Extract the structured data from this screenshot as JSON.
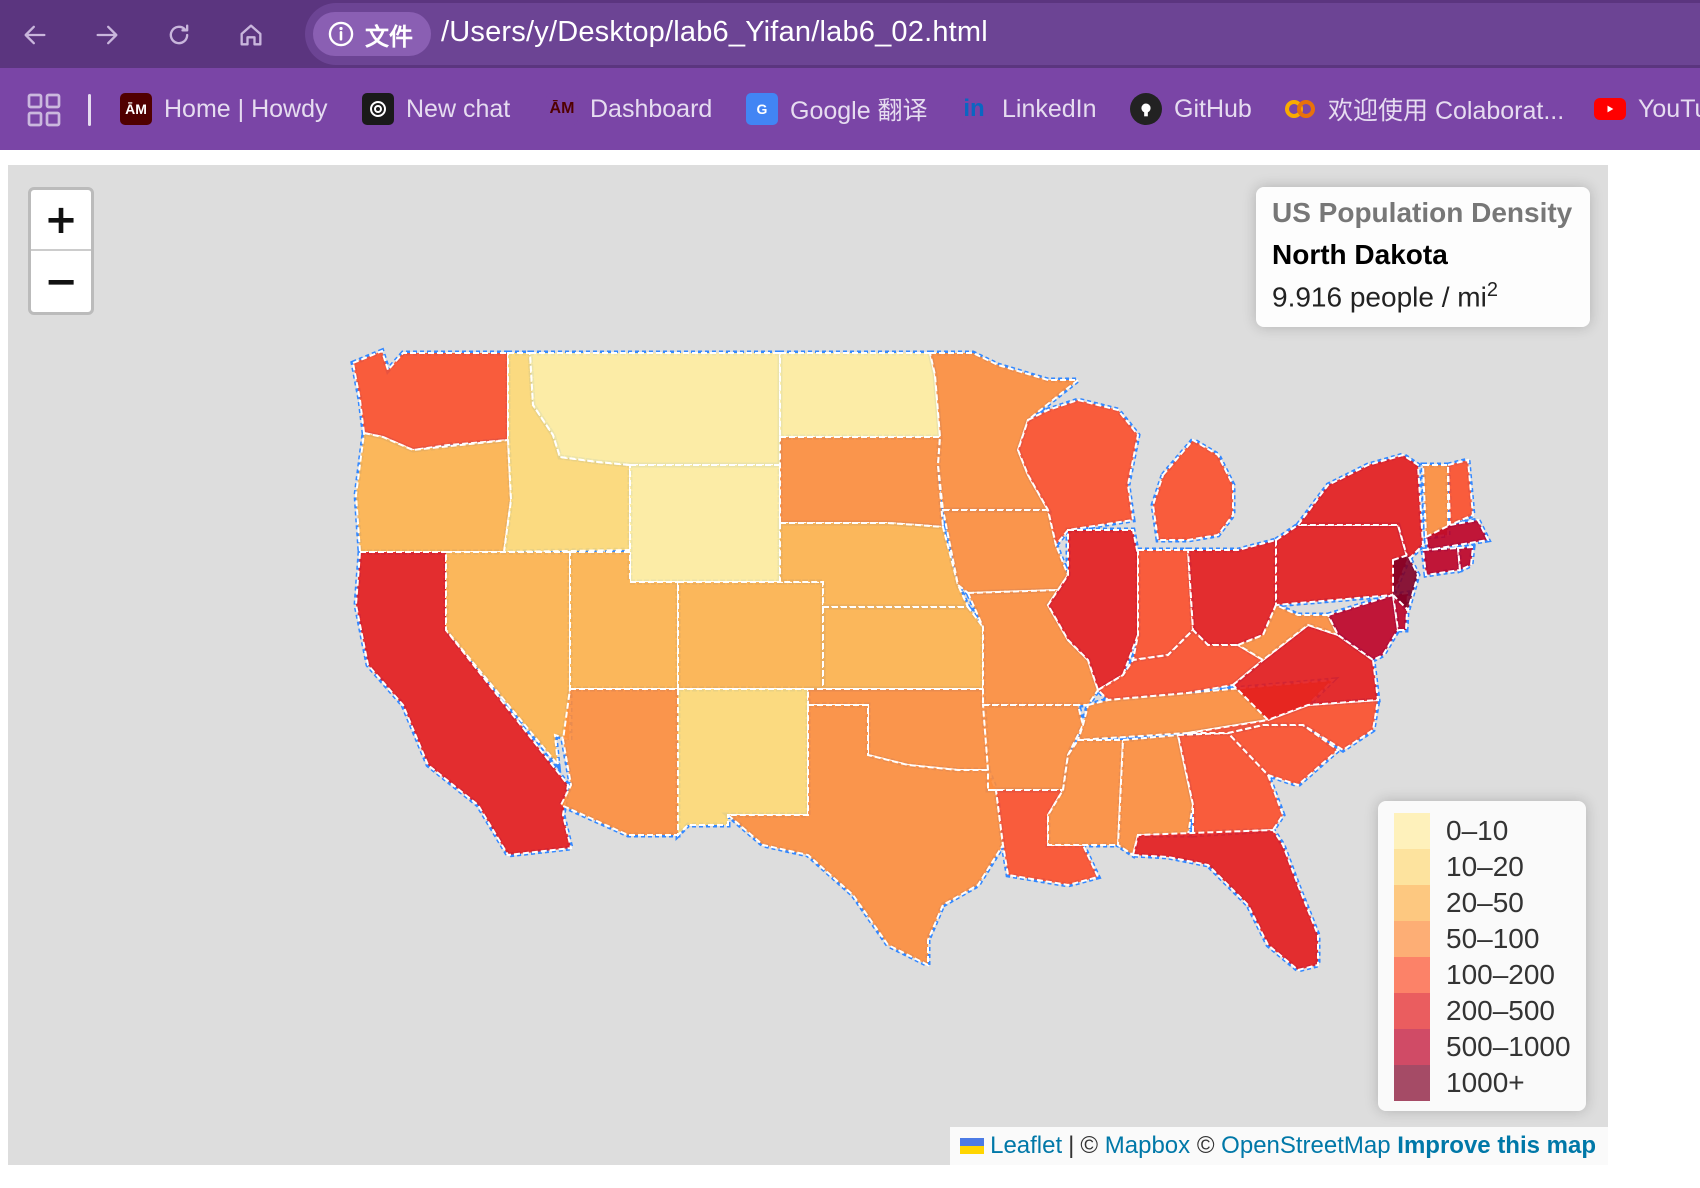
{
  "browser": {
    "site_info_label": "文件",
    "url": "/Users/y/Desktop/lab6_Yifan/lab6_02.html",
    "bookmarks": [
      {
        "label": "Home | Howdy",
        "icon": "tamu-icon",
        "color": "#500000"
      },
      {
        "label": "New chat",
        "icon": "openai-icon",
        "color": "#1a1a1a"
      },
      {
        "label": "Dashboard",
        "icon": "tamu-icon",
        "color": "#500000"
      },
      {
        "label": "Google 翻译",
        "icon": "google-translate-icon",
        "color": "#4285f4"
      },
      {
        "label": "LinkedIn",
        "icon": "linkedin-icon",
        "color": "#0a66c2"
      },
      {
        "label": "GitHub",
        "icon": "github-icon",
        "color": "#222222"
      },
      {
        "label": "欢迎使用 Colaborat...",
        "icon": "colab-icon",
        "color": "#f9ab00"
      },
      {
        "label": "YouTu",
        "icon": "youtube-icon",
        "color": "#ff0000"
      }
    ]
  },
  "map": {
    "zoom_in_label": "+",
    "zoom_out_label": "−",
    "info": {
      "title": "US Population Density",
      "state": "North Dakota",
      "value": "9.916",
      "unit": "people / mi",
      "unit_exponent": "2"
    },
    "legend": [
      {
        "label": "0–10",
        "color": "#FFEDA0"
      },
      {
        "label": "10–20",
        "color": "#FED976"
      },
      {
        "label": "20–50",
        "color": "#FEB24C"
      },
      {
        "label": "50–100",
        "color": "#FD8D3C"
      },
      {
        "label": "100–200",
        "color": "#FC4E2A"
      },
      {
        "label": "200–500",
        "color": "#E31A1C"
      },
      {
        "label": "500–1000",
        "color": "#BD0026"
      },
      {
        "label": "1000+",
        "color": "#800026"
      }
    ],
    "attribution": {
      "leaflet": "Leaflet",
      "sep": "|",
      "copy1": "©",
      "mapbox": "Mapbox",
      "copy2": "©",
      "osm": "OpenStreetMap",
      "improve": "Improve this map"
    },
    "states": [
      {
        "name": "Washington",
        "color": "#FC4E2A"
      },
      {
        "name": "Oregon",
        "color": "#FEB24C"
      },
      {
        "name": "California",
        "color": "#E31A1C"
      },
      {
        "name": "Idaho",
        "color": "#FED976"
      },
      {
        "name": "Nevada",
        "color": "#FEB24C"
      },
      {
        "name": "Montana",
        "color": "#FFEDA0"
      },
      {
        "name": "Wyoming",
        "color": "#FFEDA0"
      },
      {
        "name": "Utah",
        "color": "#FEB24C"
      },
      {
        "name": "Arizona",
        "color": "#FD8D3C"
      },
      {
        "name": "Colorado",
        "color": "#FEB24C"
      },
      {
        "name": "New Mexico",
        "color": "#FED976"
      },
      {
        "name": "North Dakota",
        "color": "#FFEDA0"
      },
      {
        "name": "South Dakota",
        "color": "#FD8D3C"
      },
      {
        "name": "Nebraska",
        "color": "#FEB24C"
      },
      {
        "name": "Kansas",
        "color": "#FEB24C"
      },
      {
        "name": "Oklahoma",
        "color": "#FD8D3C"
      },
      {
        "name": "Texas",
        "color": "#FD8D3C"
      },
      {
        "name": "Minnesota",
        "color": "#FD8D3C"
      },
      {
        "name": "Iowa",
        "color": "#FD8D3C"
      },
      {
        "name": "Missouri",
        "color": "#FD8D3C"
      },
      {
        "name": "Arkansas",
        "color": "#FD8D3C"
      },
      {
        "name": "Louisiana",
        "color": "#FC4E2A"
      },
      {
        "name": "Wisconsin",
        "color": "#FC4E2A"
      },
      {
        "name": "Illinois",
        "color": "#E31A1C"
      },
      {
        "name": "Michigan",
        "color": "#FC4E2A"
      },
      {
        "name": "Indiana",
        "color": "#FC4E2A"
      },
      {
        "name": "Ohio",
        "color": "#E31A1C"
      },
      {
        "name": "Kentucky",
        "color": "#FC4E2A"
      },
      {
        "name": "Tennessee",
        "color": "#FD8D3C"
      },
      {
        "name": "Mississippi",
        "color": "#FD8D3C"
      },
      {
        "name": "Alabama",
        "color": "#FD8D3C"
      },
      {
        "name": "Georgia",
        "color": "#FC4E2A"
      },
      {
        "name": "Florida",
        "color": "#E31A1C"
      },
      {
        "name": "South Carolina",
        "color": "#FC4E2A"
      },
      {
        "name": "North Carolina",
        "color": "#FC4E2A"
      },
      {
        "name": "Virginia",
        "color": "#E31A1C"
      },
      {
        "name": "West Virginia",
        "color": "#FD8D3C"
      },
      {
        "name": "Pennsylvania",
        "color": "#E31A1C"
      },
      {
        "name": "New York",
        "color": "#E31A1C"
      },
      {
        "name": "Maryland",
        "color": "#BD0026"
      },
      {
        "name": "Delaware",
        "color": "#BD0026"
      },
      {
        "name": "New Jersey",
        "color": "#800026"
      },
      {
        "name": "Vermont",
        "color": "#FD8D3C"
      },
      {
        "name": "New Hampshire",
        "color": "#FC4E2A"
      },
      {
        "name": "Massachusetts",
        "color": "#BD0026"
      },
      {
        "name": "Connecticut",
        "color": "#BD0026"
      },
      {
        "name": "Rhode Island",
        "color": "#BD0026"
      }
    ]
  }
}
